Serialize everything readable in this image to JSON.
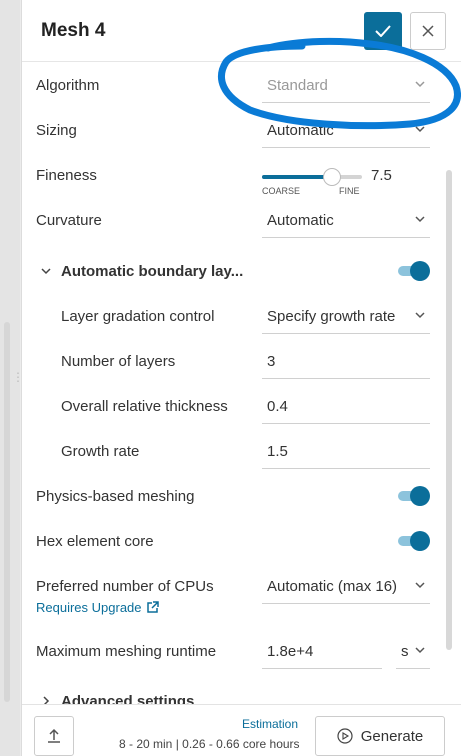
{
  "header": {
    "title": "Mesh 4"
  },
  "fields": {
    "algorithm": {
      "label": "Algorithm",
      "value": "Standard"
    },
    "sizing": {
      "label": "Sizing",
      "value": "Automatic"
    },
    "fineness": {
      "label": "Fineness",
      "value": "7.5",
      "coarse": "COARSE",
      "fine": "FINE",
      "level": 0.7
    },
    "curvature": {
      "label": "Curvature",
      "value": "Automatic"
    },
    "boundary_layers": {
      "label": "Automatic boundary lay...",
      "enabled": true
    },
    "layer_gradation": {
      "label": "Layer gradation control",
      "value": "Specify growth rate"
    },
    "num_layers": {
      "label": "Number of layers",
      "value": "3"
    },
    "overall_thickness": {
      "label": "Overall relative thickness",
      "value": "0.4"
    },
    "growth_rate": {
      "label": "Growth rate",
      "value": "1.5"
    },
    "physics_meshing": {
      "label": "Physics-based meshing",
      "enabled": true
    },
    "hex_core": {
      "label": "Hex element core",
      "enabled": true
    },
    "cpus": {
      "label": "Preferred number of CPUs",
      "value": "Automatic (max 16)",
      "upgrade_link": "Requires Upgrade"
    },
    "runtime": {
      "label": "Maximum meshing runtime",
      "value": "1.8e+4",
      "unit": "s"
    },
    "advanced": {
      "label": "Advanced settings"
    }
  },
  "footer": {
    "estimation_label": "Estimation",
    "estimation_text": "8 - 20 min | 0.26 - 0.66 core hours",
    "generate_label": "Generate"
  },
  "colors": {
    "accent": "#0b6e9a",
    "annotation": "#0a7bd6"
  }
}
